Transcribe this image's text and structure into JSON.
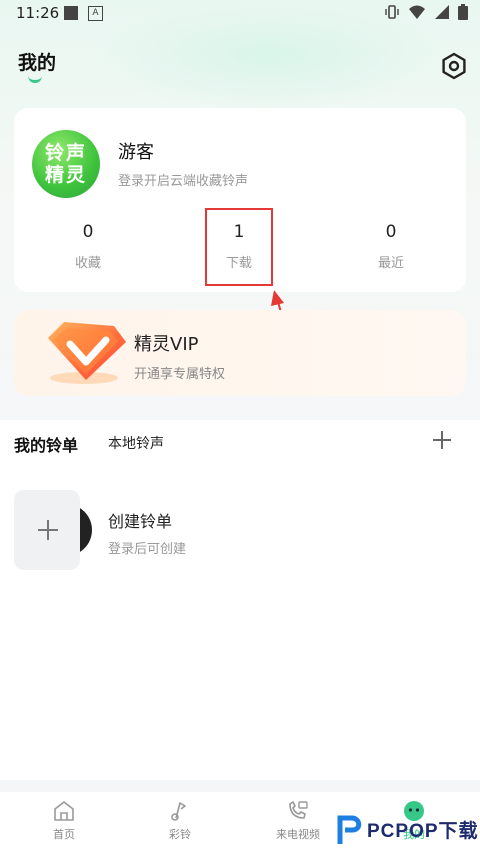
{
  "status_bar": {
    "time": "11:26",
    "a_badge": "A"
  },
  "header": {
    "title": "我的"
  },
  "profile": {
    "logo_line1": "铃声",
    "logo_line2": "精灵",
    "username": "游客",
    "login_hint": "登录开启云端收藏铃声",
    "stats": [
      {
        "value": "0",
        "label": "收藏"
      },
      {
        "value": "1",
        "label": "下载"
      },
      {
        "value": "0",
        "label": "最近"
      }
    ]
  },
  "vip": {
    "title": "精灵VIP",
    "subtitle": "开通享专属特权"
  },
  "lists": {
    "tab_mine": "我的铃单",
    "tab_local": "本地铃声",
    "create_title": "创建铃单",
    "create_sub": "登录后可创建"
  },
  "nav": {
    "items": [
      {
        "label": "首页",
        "icon": "home-icon"
      },
      {
        "label": "彩铃",
        "icon": "ringtone-icon"
      },
      {
        "label": "来电视频",
        "icon": "call-video-icon"
      },
      {
        "label": "我的",
        "icon": "profile-icon"
      }
    ]
  },
  "watermark": {
    "text": "PCPOP下载"
  },
  "colors": {
    "accent": "#36c889",
    "highlight": "#e53935",
    "logo_green": "#3dc23c"
  }
}
